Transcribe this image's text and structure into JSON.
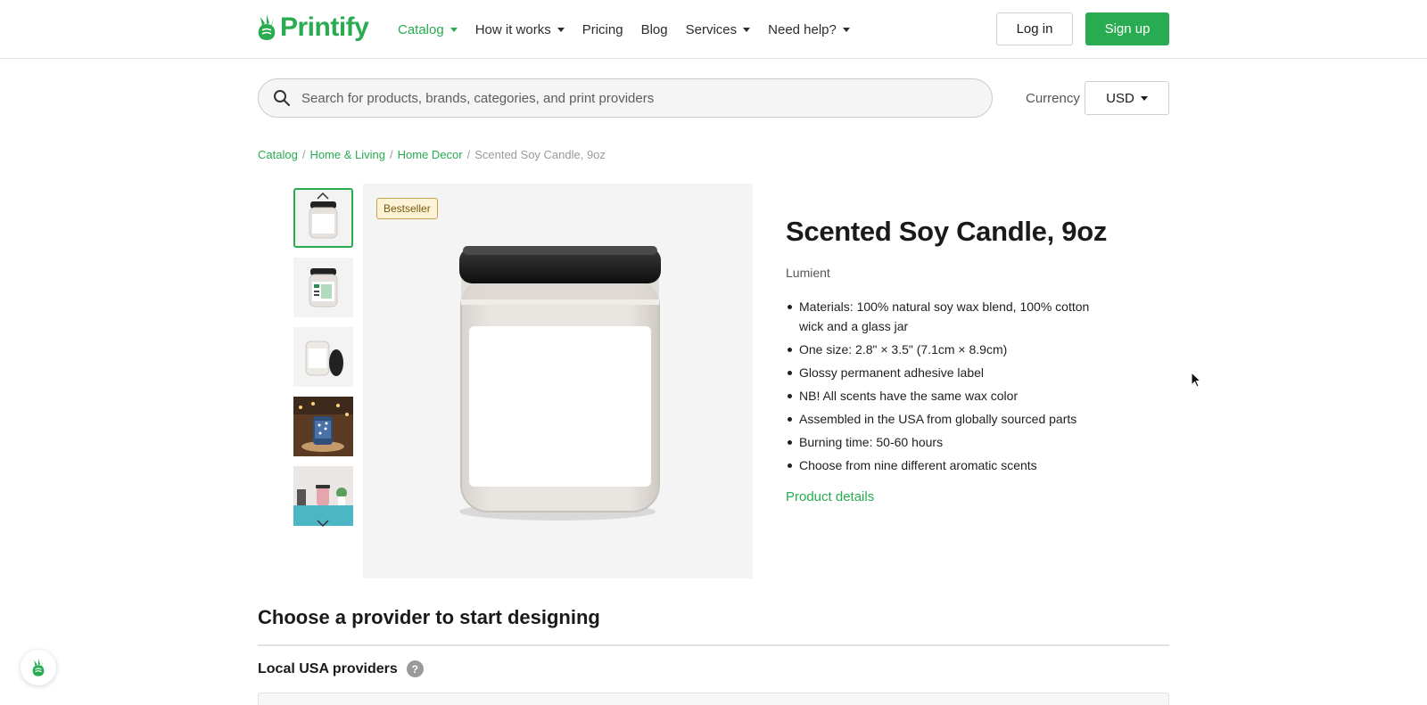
{
  "header": {
    "logo_text": "Printify",
    "nav": [
      {
        "label": "Catalog",
        "has_dropdown": true,
        "active": true
      },
      {
        "label": "How it works",
        "has_dropdown": true,
        "active": false
      },
      {
        "label": "Pricing",
        "has_dropdown": false,
        "active": false
      },
      {
        "label": "Blog",
        "has_dropdown": false,
        "active": false
      },
      {
        "label": "Services",
        "has_dropdown": true,
        "active": false
      },
      {
        "label": "Need help?",
        "has_dropdown": true,
        "active": false
      }
    ],
    "login_label": "Log in",
    "signup_label": "Sign up"
  },
  "search": {
    "placeholder": "Search for products, brands, categories, and print providers",
    "value": ""
  },
  "currency": {
    "label": "Currency",
    "selected": "USD"
  },
  "breadcrumb": {
    "items": [
      "Catalog",
      "Home & Living",
      "Home Decor"
    ],
    "current": "Scented Soy Candle, 9oz",
    "separator": "/"
  },
  "gallery": {
    "badge": "Bestseller",
    "thumbnail_count": 5,
    "selected_index": 0
  },
  "product": {
    "title": "Scented Soy Candle, 9oz",
    "brand": "Lumient",
    "features": [
      "Materials: 100% natural soy wax blend, 100% cotton wick and a glass jar",
      "One size: 2.8\" × 3.5\" (7.1cm × 8.9cm)",
      "Glossy permanent adhesive label",
      "NB! All scents have the same wax color",
      "Assembled in the USA from globally sourced parts",
      "Burning time: 50-60 hours",
      "Choose from nine different aromatic scents"
    ],
    "details_link": "Product details"
  },
  "providers": {
    "heading": "Choose a provider to start designing",
    "local_heading": "Local USA providers",
    "help_glyph": "?"
  },
  "colors": {
    "brand_green": "#29ab51",
    "badge_bg": "#fdf3d6"
  }
}
